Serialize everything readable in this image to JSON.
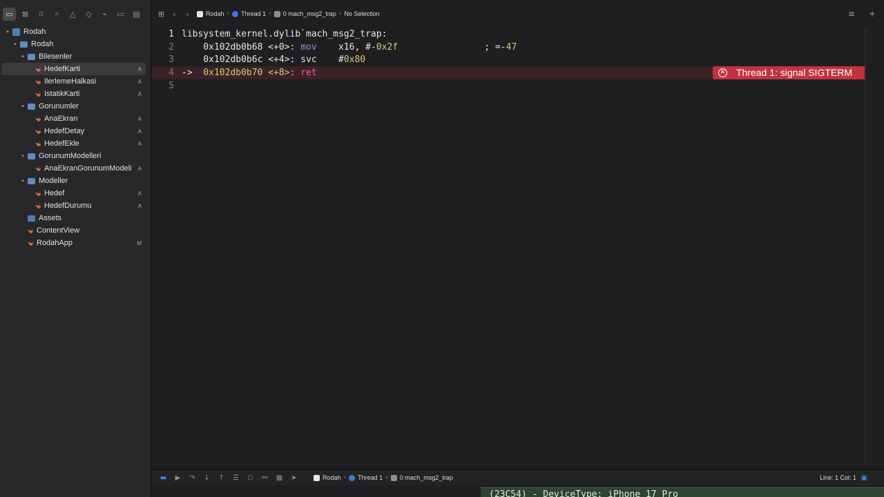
{
  "navigator": {
    "toolbar_icons": [
      "folder-icon",
      "source-control-icon",
      "bookmark-icon",
      "search-icon",
      "issue-warning-icon",
      "test-diamond-icon",
      "debug-spray-icon",
      "breakpoint-icon",
      "report-icon"
    ],
    "tree": [
      {
        "label": "Rodah",
        "level": 0,
        "kind": "proj",
        "disc": "▾",
        "badge": ""
      },
      {
        "label": "Rodah",
        "level": 1,
        "kind": "folder",
        "disc": "▾",
        "badge": ""
      },
      {
        "label": "Bilesenler",
        "level": 2,
        "kind": "folder",
        "disc": "▾",
        "badge": ""
      },
      {
        "label": "HedefKarti",
        "level": 3,
        "kind": "swift",
        "disc": "",
        "badge": "A",
        "selected": true
      },
      {
        "label": "IlerlemeHalkasi",
        "level": 3,
        "kind": "swift",
        "disc": "",
        "badge": "A"
      },
      {
        "label": "IstatikKarti",
        "level": 3,
        "kind": "swift",
        "disc": "",
        "badge": "A"
      },
      {
        "label": "Gorunumler",
        "level": 2,
        "kind": "folder",
        "disc": "▾",
        "badge": ""
      },
      {
        "label": "AnaEkran",
        "level": 3,
        "kind": "swift",
        "disc": "",
        "badge": "A"
      },
      {
        "label": "HedefDetay",
        "level": 3,
        "kind": "swift",
        "disc": "",
        "badge": "A"
      },
      {
        "label": "HedefEkle",
        "level": 3,
        "kind": "swift",
        "disc": "",
        "badge": "A"
      },
      {
        "label": "GorunumModelleri",
        "level": 2,
        "kind": "folder",
        "disc": "▾",
        "badge": ""
      },
      {
        "label": "AnaEkranGorunumModeli",
        "level": 3,
        "kind": "swift",
        "disc": "",
        "badge": "A"
      },
      {
        "label": "Modeller",
        "level": 2,
        "kind": "folder",
        "disc": "▾",
        "badge": ""
      },
      {
        "label": "Hedef",
        "level": 3,
        "kind": "swift",
        "disc": "",
        "badge": "A"
      },
      {
        "label": "HedefDurumu",
        "level": 3,
        "kind": "swift",
        "disc": "",
        "badge": "A"
      },
      {
        "label": "Assets",
        "level": 2,
        "kind": "assets",
        "disc": "",
        "badge": ""
      },
      {
        "label": "ContentView",
        "level": 2,
        "kind": "swift",
        "disc": "",
        "badge": ""
      },
      {
        "label": "RodahApp",
        "level": 2,
        "kind": "swift",
        "disc": "",
        "badge": "M"
      }
    ]
  },
  "jumpbar": {
    "project": "Rodah",
    "thread": "Thread 1",
    "frame": "0 mach_msg2_trap",
    "selection": "No Selection"
  },
  "code": {
    "lines": [
      {
        "num": "1",
        "segments": [
          {
            "t": "libsystem_kernel.dylib`mach_msg2_trap:",
            "c": "plain"
          }
        ]
      },
      {
        "num": "2",
        "segments": [
          {
            "t": "    0x102db0b68 <+0>: ",
            "c": "plain"
          },
          {
            "t": "mov",
            "c": "mv"
          },
          {
            "t": "    x16, #-",
            "c": "plain"
          },
          {
            "t": "0x2f",
            "c": "num"
          },
          {
            "t": "                ; =-",
            "c": "plain"
          },
          {
            "t": "47",
            "c": "num"
          }
        ]
      },
      {
        "num": "3",
        "segments": [
          {
            "t": "    0x102db0b6c <+4>: svc    #",
            "c": "plain"
          },
          {
            "t": "0x80",
            "c": "num"
          }
        ]
      },
      {
        "num": "4",
        "arrow": "->",
        "segments": [
          {
            "t": "  0x102db0b70 <+8>: ",
            "c": "num"
          },
          {
            "t": "ret",
            "c": "kw"
          }
        ],
        "error": "Thread 1: signal SIGTERM"
      },
      {
        "num": "5",
        "segments": []
      }
    ]
  },
  "debugbar": {
    "project": "Rodah",
    "thread": "Thread 1",
    "frame": "0 mach_msg2_trap",
    "position": "Line: 1  Col: 1"
  },
  "console": {
    "text": "(23C54) - DeviceType: iPhone 17 Pro"
  }
}
